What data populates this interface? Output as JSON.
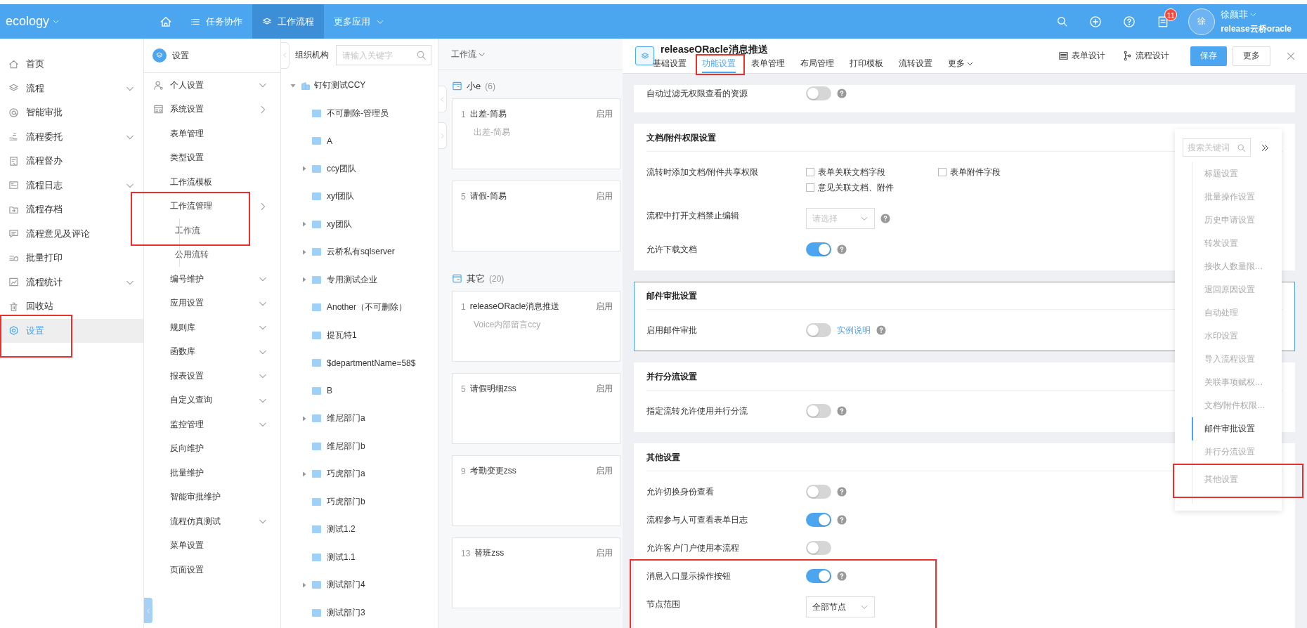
{
  "topbar": {
    "brand": "ecology",
    "nav": [
      {
        "label": "任务协作",
        "kind": "list",
        "selected": false
      },
      {
        "label": "工作流程",
        "kind": "layers",
        "selected": true
      },
      {
        "label": "更多应用",
        "kind": "dropdown",
        "selected": false
      }
    ],
    "notification_count": "11",
    "avatar": "徐",
    "user_name": "徐颜菲",
    "user_org": "release云桥oracle"
  },
  "sidebar": {
    "items": [
      {
        "label": "首页",
        "expandable": false,
        "selected": false,
        "highlighted": false
      },
      {
        "label": "流程",
        "expandable": true,
        "selected": false,
        "highlighted": false
      },
      {
        "label": "智能审批",
        "expandable": false,
        "selected": false,
        "highlighted": false
      },
      {
        "label": "流程委托",
        "expandable": true,
        "selected": false,
        "highlighted": false
      },
      {
        "label": "流程督办",
        "expandable": false,
        "selected": false,
        "highlighted": false
      },
      {
        "label": "流程日志",
        "expandable": true,
        "selected": false,
        "highlighted": false
      },
      {
        "label": "流程存档",
        "expandable": false,
        "selected": false,
        "highlighted": false
      },
      {
        "label": "流程意见及评论",
        "expandable": false,
        "selected": false,
        "highlighted": false
      },
      {
        "label": "批量打印",
        "expandable": false,
        "selected": false,
        "highlighted": false
      },
      {
        "label": "流程统计",
        "expandable": true,
        "selected": false,
        "highlighted": false
      },
      {
        "label": "回收站",
        "expandable": false,
        "selected": false,
        "highlighted": false
      },
      {
        "label": "设置",
        "expandable": false,
        "selected": true,
        "highlighted": true
      }
    ]
  },
  "settings_menu": {
    "title": "设置",
    "items": [
      {
        "label": "个人设置",
        "kind": "group",
        "highlighted": false
      },
      {
        "label": "系统设置",
        "kind": "submenu",
        "highlighted": false
      },
      {
        "label": "表单管理",
        "kind": "page",
        "highlighted": false
      },
      {
        "label": "类型设置",
        "kind": "page",
        "highlighted": false
      },
      {
        "label": "工作流模板",
        "kind": "page",
        "highlighted": false
      },
      {
        "label": "工作流管理",
        "kind": "submenu",
        "highlighted": true,
        "children": [
          {
            "label": "工作流",
            "highlighted": true
          },
          {
            "label": "公用流转",
            "highlighted": false
          }
        ]
      },
      {
        "label": "编号维护",
        "kind": "group",
        "highlighted": false
      },
      {
        "label": "应用设置",
        "kind": "group",
        "highlighted": false
      },
      {
        "label": "规则库",
        "kind": "group",
        "highlighted": false
      },
      {
        "label": "函数库",
        "kind": "group",
        "highlighted": false
      },
      {
        "label": "报表设置",
        "kind": "group",
        "highlighted": false
      },
      {
        "label": "自定义查询",
        "kind": "group",
        "highlighted": false
      },
      {
        "label": "监控管理",
        "kind": "group",
        "highlighted": false
      },
      {
        "label": "反向维护",
        "kind": "page",
        "highlighted": false
      },
      {
        "label": "批量维护",
        "kind": "page",
        "highlighted": false
      },
      {
        "label": "智能审批维护",
        "kind": "page",
        "highlighted": false
      },
      {
        "label": "流程仿真测试",
        "kind": "group",
        "highlighted": false
      },
      {
        "label": "菜单设置",
        "kind": "page",
        "highlighted": false
      },
      {
        "label": "页面设置",
        "kind": "page",
        "highlighted": false
      }
    ]
  },
  "org_tree": {
    "title": "组织机构",
    "search_placeholder": "请输入关键字",
    "nodes": [
      {
        "label": "钉钉测试CCY",
        "kind": "company",
        "expandable": true,
        "expanded": true,
        "children": [
          {
            "label": "不可删除-管理员",
            "kind": "department",
            "expandable": false
          },
          {
            "label": "A",
            "kind": "department",
            "expandable": false
          },
          {
            "label": "ccy团队",
            "kind": "department",
            "expandable": true,
            "expanded": false
          },
          {
            "label": "xyf团队",
            "kind": "department",
            "expandable": false
          },
          {
            "label": "xy团队",
            "kind": "department",
            "expandable": true,
            "expanded": false
          },
          {
            "label": "云桥私有sqlserver",
            "kind": "department",
            "expandable": true,
            "expanded": false
          },
          {
            "label": "专用测试企业",
            "kind": "department",
            "expandable": true,
            "expanded": false
          },
          {
            "label": "Another（不可删除）",
            "kind": "department",
            "expandable": false
          },
          {
            "label": "提瓦特1",
            "kind": "department",
            "expandable": false
          },
          {
            "label": "$departmentName=58$",
            "kind": "department",
            "expandable": false
          },
          {
            "label": "B",
            "kind": "department",
            "expandable": false
          },
          {
            "label": "维尼部门a",
            "kind": "department",
            "expandable": true,
            "expanded": false
          },
          {
            "label": "维尼部门b",
            "kind": "department",
            "expandable": false
          },
          {
            "label": "巧虎部门a",
            "kind": "department",
            "expandable": true,
            "expanded": false
          },
          {
            "label": "巧虎部门b",
            "kind": "department",
            "expandable": false
          },
          {
            "label": "测试1.2",
            "kind": "department",
            "expandable": false
          },
          {
            "label": "测试1.1",
            "kind": "department",
            "expandable": false
          },
          {
            "label": "测试部门4",
            "kind": "department",
            "expandable": true,
            "expanded": false
          },
          {
            "label": "测试部门3",
            "kind": "department",
            "expandable": false
          }
        ]
      }
    ]
  },
  "workflows": {
    "title": "工作流",
    "groups": [
      {
        "name": "小e",
        "count": "(6)",
        "items": [
          {
            "number": "1",
            "name": "出差-简易",
            "description": "出差-简易",
            "status": "启用"
          },
          {
            "number": "5",
            "name": "请假-简易",
            "status": "启用"
          }
        ]
      },
      {
        "name": "其它",
        "count": "(20)",
        "items": [
          {
            "number": "1",
            "name": "releaseORacle消息推送",
            "description": "Voice内部留言ccy",
            "status": "启用"
          },
          {
            "number": "5",
            "name": "请假明细zss",
            "status": "启用"
          },
          {
            "number": "9",
            "name": "考勤变更zss",
            "status": "启用"
          },
          {
            "number": "13",
            "name": "替班zss",
            "status": "启用"
          }
        ]
      }
    ]
  },
  "editor": {
    "title": "releaseORacle消息推送",
    "tabs": [
      {
        "label": "基础设置",
        "kind": "plain",
        "selected": false,
        "highlighted": false
      },
      {
        "label": "功能设置",
        "kind": "plain",
        "selected": true,
        "highlighted": true
      },
      {
        "label": "表单管理",
        "kind": "plain",
        "selected": false,
        "highlighted": false
      },
      {
        "label": "布局管理",
        "kind": "plain",
        "selected": false,
        "highlighted": false
      },
      {
        "label": "打印模板",
        "kind": "plain",
        "selected": false,
        "highlighted": false
      },
      {
        "label": "流转设置",
        "kind": "plain",
        "selected": false,
        "highlighted": false
      },
      {
        "label": "更多",
        "kind": "dropdown",
        "selected": false,
        "highlighted": false
      }
    ],
    "actions": [
      {
        "label": "表单设计",
        "kind": "form-design"
      },
      {
        "label": "流程设计",
        "kind": "flow-design"
      },
      {
        "label": "保存",
        "kind": "primary"
      },
      {
        "label": "更多",
        "kind": "default"
      }
    ],
    "sections": [
      {
        "focused": false,
        "rows": [
          {
            "label": "自动过滤无权限查看的资源",
            "kind": "toggle",
            "on": false,
            "help": true,
            "highlighted": false
          }
        ]
      },
      {
        "title": "文档/附件权限设置",
        "focused": false,
        "rows": [
          {
            "label": "流转时添加文档/附件共享权限",
            "kind": "checkboxes",
            "highlighted": false,
            "options": [
              {
                "label": "表单关联文档字段",
                "checked": false
              },
              {
                "label": "表单附件字段",
                "checked": false
              },
              {
                "label": "意见关联文档、附件",
                "checked": false
              }
            ]
          },
          {
            "label": "流程中打开文档禁止编辑",
            "kind": "select",
            "placeholder": "请选择",
            "help": true,
            "highlighted": false
          },
          {
            "label": "允许下载文档",
            "kind": "toggle",
            "on": true,
            "help": true,
            "highlighted": false
          }
        ]
      },
      {
        "title": "邮件审批设置",
        "focused": true,
        "rows": [
          {
            "label": "启用邮件审批",
            "kind": "toggle",
            "on": false,
            "link": "实例说明",
            "help": true,
            "highlighted": false
          }
        ]
      },
      {
        "title": "并行分流设置",
        "focused": false,
        "rows": [
          {
            "label": "指定流转允许使用并行分流",
            "kind": "toggle",
            "on": false,
            "help": true,
            "highlighted": false
          }
        ]
      },
      {
        "title": "其他设置",
        "focused": false,
        "rows": [
          {
            "label": "允许切换身份查看",
            "kind": "toggle",
            "on": false,
            "help": true,
            "highlighted": false
          },
          {
            "label": "流程参与人可查看表单日志",
            "kind": "toggle",
            "on": true,
            "help": true,
            "highlighted": false
          },
          {
            "label": "允许客户门户使用本流程",
            "kind": "toggle",
            "on": false,
            "help": false,
            "highlighted": false
          },
          {
            "label": "消息入口显示操作按钮",
            "kind": "toggle",
            "on": true,
            "help": true,
            "highlighted": true
          },
          {
            "label": "节点范围",
            "kind": "select",
            "value": "全部节点",
            "help": false,
            "highlighted": true
          }
        ]
      }
    ]
  },
  "anchor": {
    "search_placeholder": "搜索关键词",
    "items": [
      {
        "label": "标题设置",
        "selected": false,
        "highlighted": false
      },
      {
        "label": "批量操作设置",
        "selected": false,
        "highlighted": false
      },
      {
        "label": "历史申请设置",
        "selected": false,
        "highlighted": false
      },
      {
        "label": "转发设置",
        "selected": false,
        "highlighted": false
      },
      {
        "label": "接收人数量限…",
        "selected": false,
        "highlighted": false
      },
      {
        "label": "退回原因设置",
        "selected": false,
        "highlighted": false
      },
      {
        "label": "自动处理",
        "selected": false,
        "highlighted": false
      },
      {
        "label": "水印设置",
        "selected": false,
        "highlighted": false
      },
      {
        "label": "导入流程设置",
        "selected": false,
        "highlighted": false
      },
      {
        "label": "关联事项赋权…",
        "selected": false,
        "highlighted": false
      },
      {
        "label": "文档/附件权限…",
        "selected": false,
        "highlighted": false
      },
      {
        "label": "邮件审批设置",
        "selected": true,
        "highlighted": false
      },
      {
        "label": "并行分流设置",
        "selected": false,
        "highlighted": false
      },
      {
        "label": "其他设置",
        "selected": false,
        "highlighted": true
      }
    ]
  }
}
